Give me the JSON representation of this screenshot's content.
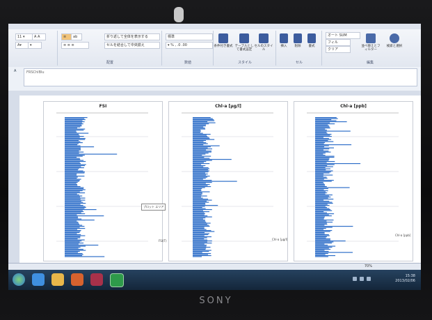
{
  "device": {
    "brand": "SONY"
  },
  "ribbon": {
    "groups": [
      {
        "label": "配置"
      },
      {
        "label": "数値"
      },
      {
        "label": "スタイル"
      },
      {
        "label": "セル"
      },
      {
        "label": "編集"
      }
    ],
    "wrap_label": "折り返して全体を表示する",
    "merge_label": "セルを結合して中央揃え",
    "number_format": "標準",
    "style_buttons": [
      {
        "label": "条件付き書式"
      },
      {
        "label": "テーブルとして書式設定"
      },
      {
        "label": "セルのスタイル"
      }
    ],
    "cell_buttons": [
      {
        "label": "挿入"
      },
      {
        "label": "削除"
      },
      {
        "label": "書式"
      }
    ],
    "edit_buttons": [
      {
        "label": "オート SUM"
      },
      {
        "label": "フィル"
      },
      {
        "label": "クリア"
      },
      {
        "label": "並べ替えとフィルター"
      },
      {
        "label": "検索と選択"
      }
    ]
  },
  "formula_bar": {
    "name_box": "A",
    "content": "FRSChlBlu"
  },
  "charts": [
    {
      "title": "FSI",
      "legend": "FSI(T)",
      "tooltip": "プロット エリア"
    },
    {
      "title": "Chl-a [µg/l]",
      "legend": "Chl-a [µg/l]"
    },
    {
      "title": "Chl-a [ppb]",
      "legend": "Chl-a [ppb]"
    }
  ],
  "status": {
    "zoom": "70%"
  },
  "taskbar": {
    "time": "15:38",
    "date": "2013/02/06",
    "apps": [
      {
        "icon": "ie-icon"
      },
      {
        "icon": "explorer-icon"
      },
      {
        "icon": "media-icon"
      },
      {
        "icon": "access-icon"
      },
      {
        "icon": "excel-icon"
      }
    ]
  },
  "colors": {
    "bars": "#2f6fc9",
    "ribbon_icon": "#3c5c9e",
    "taskbar": "#1b3250"
  }
}
